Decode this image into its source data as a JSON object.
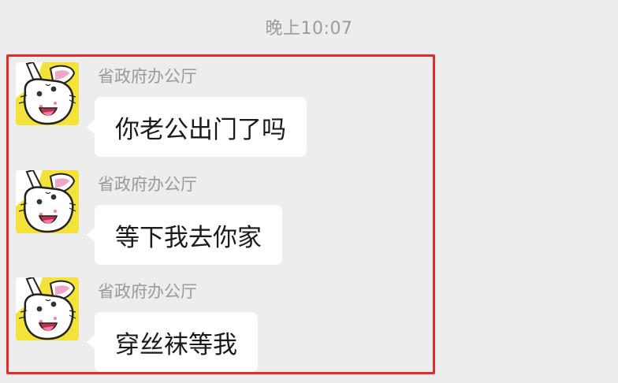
{
  "timestamp": "晚上10:07",
  "messages": [
    {
      "sender": "省政府办公厅",
      "text": "你老公出门了吗",
      "avatar_icon": "bunny-avatar-icon"
    },
    {
      "sender": "省政府办公厅",
      "text": "等下我去你家",
      "avatar_icon": "bunny-avatar-icon"
    },
    {
      "sender": "省政府办公厅",
      "text": "穿丝袜等我",
      "avatar_icon": "bunny-avatar-icon"
    }
  ],
  "colors": {
    "background": "#ededed",
    "bubble": "#ffffff",
    "highlight_border": "#e32b2b",
    "avatar_yellow": "#f2e23a"
  }
}
